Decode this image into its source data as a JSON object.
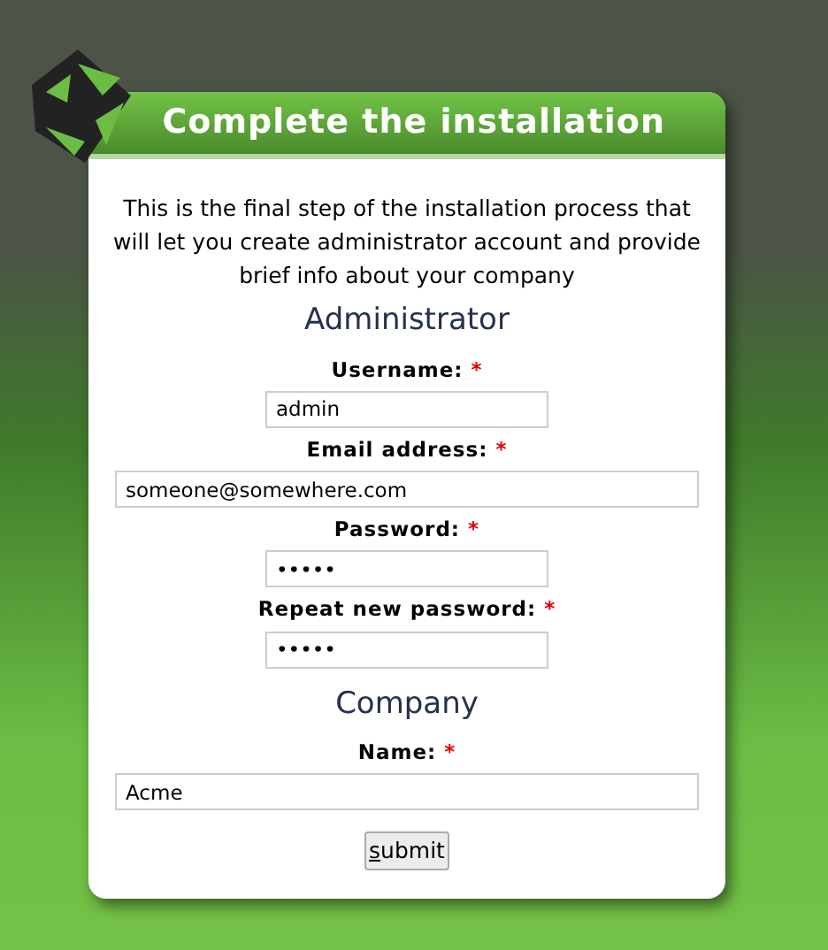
{
  "panel": {
    "title": "Complete the installation",
    "intro": "This is the final step of the installation process that will let you create administrator account and provide brief info about your company",
    "sections": [
      {
        "heading": "Administrator",
        "fields": [
          {
            "label": "Username:",
            "required_mark": "*",
            "value": "admin",
            "kind": "short"
          },
          {
            "label": "Email address:",
            "required_mark": "*",
            "value": "someone@somewhere.com",
            "kind": "wide"
          },
          {
            "label": "Password:",
            "required_mark": "*",
            "value": "•••••",
            "kind": "short"
          },
          {
            "label": "Repeat new password:",
            "required_mark": "*",
            "value": "•••••",
            "kind": "short"
          }
        ]
      },
      {
        "heading": "Company",
        "fields": [
          {
            "label": "Name:",
            "required_mark": "*",
            "value": "Acme",
            "kind": "wide"
          }
        ]
      }
    ],
    "submit_button": {
      "access_key": "s",
      "label_rest": "ubmit"
    }
  }
}
